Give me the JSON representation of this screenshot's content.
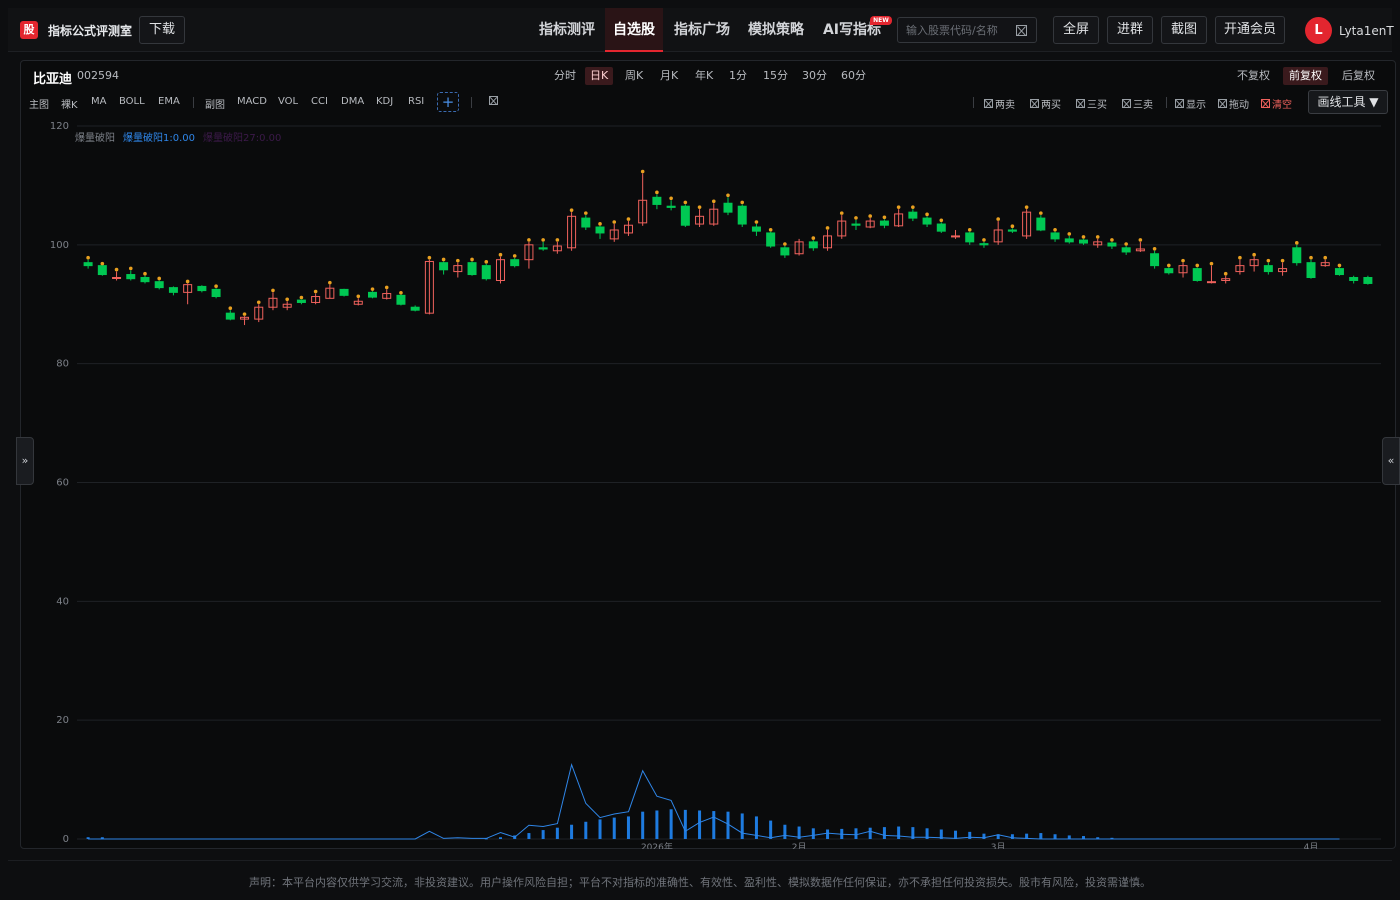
{
  "header": {
    "logo_text": "股",
    "app_title": "指标公式评测室",
    "download_label": "下载",
    "nav": [
      {
        "label": "指标测评",
        "active": false
      },
      {
        "label": "自选股",
        "active": true
      },
      {
        "label": "指标广场",
        "active": false
      },
      {
        "label": "模拟策略",
        "active": false
      },
      {
        "label": "AI写指标",
        "active": false
      }
    ],
    "new_badge": "NEW",
    "search_placeholder": "输入股票代码/名称",
    "actions": [
      "全屏",
      "进群",
      "截图",
      "开通会员"
    ],
    "avatar_letter": "L",
    "username": "Lyta1enT"
  },
  "stock": {
    "name": "比亚迪",
    "code": "002594"
  },
  "periods": [
    {
      "label": "分时",
      "active": false
    },
    {
      "label": "日K",
      "active": true
    },
    {
      "label": "周K",
      "active": false
    },
    {
      "label": "月K",
      "active": false
    },
    {
      "label": "年K",
      "active": false
    },
    {
      "label": "1分",
      "active": false
    },
    {
      "label": "15分",
      "active": false
    },
    {
      "label": "30分",
      "active": false
    },
    {
      "label": "60分",
      "active": false
    }
  ],
  "adjust": [
    {
      "label": "不复权",
      "active": false
    },
    {
      "label": "前复权",
      "active": true
    },
    {
      "label": "后复权",
      "active": false
    }
  ],
  "indicators_main": [
    "主图",
    "裸K",
    "MA",
    "BOLL",
    "EMA"
  ],
  "indicators_sub": [
    "副图",
    "MACD",
    "VOL",
    "CCI",
    "DMA",
    "KDJ",
    "RSI"
  ],
  "plus_label": "+",
  "signal_toggles": [
    "两卖",
    "两买",
    "三买",
    "三卖"
  ],
  "view_toggles": [
    "显示",
    "拖动"
  ],
  "clear_label": "清空",
  "draw_tool_label": "画线工具 ▼",
  "legend": {
    "title": "爆量破阳",
    "series1": "爆量破阳1:0.00",
    "series2": "爆量破阳27:0.00"
  },
  "colors": {
    "up": "#f0625d",
    "down": "#00c853",
    "bars": "#1e7be0",
    "line": "#2f86e8",
    "marker": "#e8a020",
    "accent": "#e3262f"
  },
  "side_handles": {
    "left": "»",
    "right": "«"
  },
  "footer_text": "声明：本平台内容仅供学习交流，非投资建议。用户操作风险自担；平台不对指标的准确性、有效性、盈利性、模拟数据作任何保证，亦不承担任何投资损失。股市有风险，投资需谨慎。",
  "chart_data": {
    "type": "candlestick",
    "ylim": [
      0,
      120
    ],
    "y_ticks": [
      0,
      20,
      40,
      60,
      80,
      100,
      120
    ],
    "x_labels": [
      {
        "index": 40,
        "label": "2026年"
      },
      {
        "index": 50,
        "label": "2月"
      },
      {
        "index": 64,
        "label": "3月"
      },
      {
        "index": 86,
        "label": "4月"
      }
    ],
    "candles": [
      [
        97,
        96.5,
        97.5,
        96
      ],
      [
        96.5,
        95,
        96.5,
        94.8
      ],
      [
        94.5,
        94.5,
        95.5,
        94
      ],
      [
        95,
        94.3,
        95.7,
        94
      ],
      [
        94.5,
        93.8,
        94.8,
        93.5
      ],
      [
        93.8,
        92.8,
        94,
        92.5
      ],
      [
        92.8,
        92,
        93,
        91.5
      ],
      [
        92,
        93.3,
        93.5,
        90
      ],
      [
        93,
        92.3,
        93.2,
        92
      ],
      [
        92.5,
        91.3,
        92.7,
        91
      ],
      [
        88.5,
        87.5,
        89,
        87.3
      ],
      [
        87.5,
        87.8,
        88,
        86.5
      ],
      [
        87.5,
        89.5,
        90,
        87
      ],
      [
        89.5,
        91,
        92,
        89
      ],
      [
        89.5,
        90,
        90.5,
        89
      ],
      [
        90.7,
        90.3,
        90.8,
        90
      ],
      [
        90.3,
        91.3,
        91.8,
        90
      ],
      [
        91,
        92.7,
        93.3,
        91
      ],
      [
        92.5,
        91.5,
        92.6,
        91.3
      ],
      [
        90,
        90.5,
        91,
        89.8
      ],
      [
        92,
        91.2,
        92.2,
        91
      ],
      [
        91,
        91.8,
        92.5,
        90.8
      ],
      [
        91.5,
        90,
        91.6,
        89.8
      ],
      [
        89.5,
        89,
        89.8,
        88.8
      ],
      [
        88.5,
        97.2,
        97.5,
        88.3
      ],
      [
        97,
        95.8,
        97.2,
        95
      ],
      [
        95.5,
        96.5,
        97,
        94.5
      ],
      [
        97,
        95,
        97.2,
        94.8
      ],
      [
        96.5,
        94.3,
        96.8,
        94
      ],
      [
        94,
        97.5,
        98,
        93.5
      ],
      [
        97.5,
        96.5,
        97.8,
        96.2
      ],
      [
        97.5,
        100,
        100.5,
        96
      ],
      [
        99.5,
        99.3,
        100.5,
        99
      ],
      [
        99,
        99.8,
        100.5,
        98.5
      ],
      [
        99.5,
        104.8,
        105.5,
        99
      ],
      [
        104.5,
        103,
        105,
        102.5
      ],
      [
        103,
        102,
        103.2,
        101
      ],
      [
        101,
        102.5,
        103.5,
        100.5
      ],
      [
        102,
        103.3,
        104,
        101.5
      ],
      [
        103.7,
        107.5,
        112,
        103.2
      ],
      [
        108,
        106.8,
        108.5,
        106
      ],
      [
        106.5,
        106.3,
        107.5,
        105.8
      ],
      [
        106.5,
        103.3,
        106.8,
        103
      ],
      [
        103.5,
        104.8,
        106,
        103
      ],
      [
        103.5,
        106,
        107,
        103.2
      ],
      [
        107,
        105.5,
        108,
        105
      ],
      [
        106.5,
        103.5,
        106.8,
        103
      ],
      [
        103,
        102.3,
        103.5,
        101.5
      ],
      [
        102,
        99.8,
        102.2,
        99.5
      ],
      [
        99.5,
        98.3,
        99.8,
        97.8
      ],
      [
        98.5,
        100.5,
        101,
        98.2
      ],
      [
        100.5,
        99.5,
        100.8,
        99
      ],
      [
        99.5,
        101.5,
        102.5,
        99
      ],
      [
        101.5,
        104,
        105,
        101
      ],
      [
        103.5,
        103.3,
        104.2,
        102.5
      ],
      [
        103,
        104,
        104.5,
        102.8
      ],
      [
        104,
        103.3,
        104.3,
        102.8
      ],
      [
        103.2,
        105.2,
        106,
        103
      ],
      [
        105.5,
        104.5,
        106,
        104
      ],
      [
        104.5,
        103.5,
        104.8,
        103
      ],
      [
        103.5,
        102.3,
        103.8,
        102
      ],
      [
        101.5,
        101.5,
        102.5,
        101
      ],
      [
        102,
        100.5,
        102.2,
        100
      ],
      [
        100.2,
        100,
        100.5,
        99.5
      ],
      [
        100.5,
        102.5,
        104,
        100
      ],
      [
        102.5,
        102.3,
        102.8,
        102
      ],
      [
        101.5,
        105.5,
        106,
        101
      ],
      [
        104.5,
        102.5,
        105,
        102.3
      ],
      [
        102,
        101,
        102.2,
        100.5
      ],
      [
        101,
        100.5,
        101.5,
        100.2
      ],
      [
        100.8,
        100.3,
        101,
        100
      ],
      [
        100,
        100.5,
        101,
        99.5
      ],
      [
        100.3,
        99.8,
        100.5,
        99.3
      ],
      [
        99.5,
        98.8,
        99.8,
        98.3
      ],
      [
        99,
        99.3,
        100.5,
        98.8
      ],
      [
        98.5,
        96.5,
        99,
        96
      ],
      [
        96,
        95.3,
        96.2,
        95
      ],
      [
        95.3,
        96.5,
        97,
        94.5
      ],
      [
        96,
        94,
        96.2,
        93.8
      ],
      [
        93.8,
        93.8,
        96.5,
        93.5
      ],
      [
        94,
        94.3,
        94.8,
        93.5
      ],
      [
        95.5,
        96.5,
        97.5,
        95
      ],
      [
        96.5,
        97.5,
        98,
        95.5
      ],
      [
        96.5,
        95.5,
        97,
        95
      ],
      [
        95.5,
        96,
        97,
        94.8
      ],
      [
        99.5,
        97,
        100,
        96.5
      ],
      [
        97,
        94.5,
        97.5,
        94.3
      ],
      [
        96.5,
        97,
        97.5,
        96.3
      ],
      [
        96,
        95,
        96.2,
        94.8
      ],
      [
        94.5,
        94,
        94.8,
        93.5
      ],
      [
        94.5,
        93.5,
        94.8,
        93.3
      ]
    ],
    "marker_indices": [
      0,
      1,
      2,
      3,
      4,
      5,
      7,
      9,
      10,
      11,
      12,
      13,
      14,
      15,
      16,
      17,
      19,
      20,
      21,
      22,
      24,
      25,
      26,
      27,
      28,
      29,
      30,
      31,
      32,
      33,
      34,
      35,
      36,
      37,
      38,
      39,
      40,
      41,
      42,
      43,
      44,
      45,
      46,
      47,
      48,
      49,
      51,
      52,
      53,
      54,
      55,
      56,
      57,
      58,
      59,
      60,
      62,
      63,
      64,
      65,
      66,
      67,
      68,
      69,
      70,
      71,
      72,
      73,
      74,
      75,
      76,
      77,
      78,
      79,
      80,
      81,
      82,
      83,
      84,
      85,
      86,
      87,
      88
    ],
    "bar_series": {
      "name": "爆量破阳1",
      "values": [
        [
          0,
          0.3
        ],
        [
          1,
          0.3
        ],
        [
          28,
          0.1
        ],
        [
          29,
          0.3
        ],
        [
          30,
          0.6
        ],
        [
          31,
          1
        ],
        [
          32,
          1.5
        ],
        [
          33,
          1.9
        ],
        [
          34,
          2.4
        ],
        [
          35,
          2.9
        ],
        [
          36,
          3.3
        ],
        [
          37,
          3.6
        ],
        [
          38,
          3.8
        ],
        [
          39,
          4.6
        ],
        [
          40,
          4.8
        ],
        [
          41,
          5
        ],
        [
          42,
          4.9
        ],
        [
          43,
          4.8
        ],
        [
          44,
          4.7
        ],
        [
          45,
          4.6
        ],
        [
          46,
          4.3
        ],
        [
          47,
          3.8
        ],
        [
          48,
          3.1
        ],
        [
          49,
          2.4
        ],
        [
          50,
          2.1
        ],
        [
          51,
          1.8
        ],
        [
          52,
          1.6
        ],
        [
          53,
          1.7
        ],
        [
          54,
          1.8
        ],
        [
          55,
          1.9
        ],
        [
          56,
          2
        ],
        [
          57,
          2.1
        ],
        [
          58,
          2
        ],
        [
          59,
          1.8
        ],
        [
          60,
          1.6
        ],
        [
          61,
          1.4
        ],
        [
          62,
          1.2
        ],
        [
          63,
          0.9
        ],
        [
          64,
          0.8
        ],
        [
          65,
          0.8
        ],
        [
          66,
          0.9
        ],
        [
          67,
          1
        ],
        [
          68,
          0.8
        ],
        [
          69,
          0.6
        ],
        [
          70,
          0.5
        ],
        [
          71,
          0.3
        ],
        [
          72,
          0.2
        ]
      ]
    },
    "line_series": {
      "name": "爆量破阳27",
      "values": [
        0,
        0,
        0,
        0,
        0,
        0,
        0,
        0,
        0,
        0,
        0,
        0,
        0,
        0,
        0,
        0,
        0,
        0,
        0,
        0,
        0,
        0,
        0,
        0,
        1.3,
        0.1,
        0.2,
        0.1,
        0.1,
        1.1,
        0.3,
        2.3,
        2.1,
        2.6,
        12.5,
        6,
        3.6,
        4.2,
        4.6,
        11.5,
        7.2,
        6.5,
        1.3,
        2.8,
        3.7,
        2.5,
        1,
        0.6,
        0.2,
        0.6,
        0.3,
        0.6,
        1,
        0.8,
        0.7,
        1.3,
        0.6,
        0.5,
        0.3,
        0.3,
        0.2,
        0.1,
        0.3,
        0.2,
        0.7,
        0.2,
        0.1,
        0,
        0,
        0,
        0,
        0,
        0,
        0,
        0,
        0,
        0,
        0,
        0,
        0,
        0,
        0,
        0,
        0,
        0,
        0,
        0,
        0,
        0
      ]
    }
  }
}
